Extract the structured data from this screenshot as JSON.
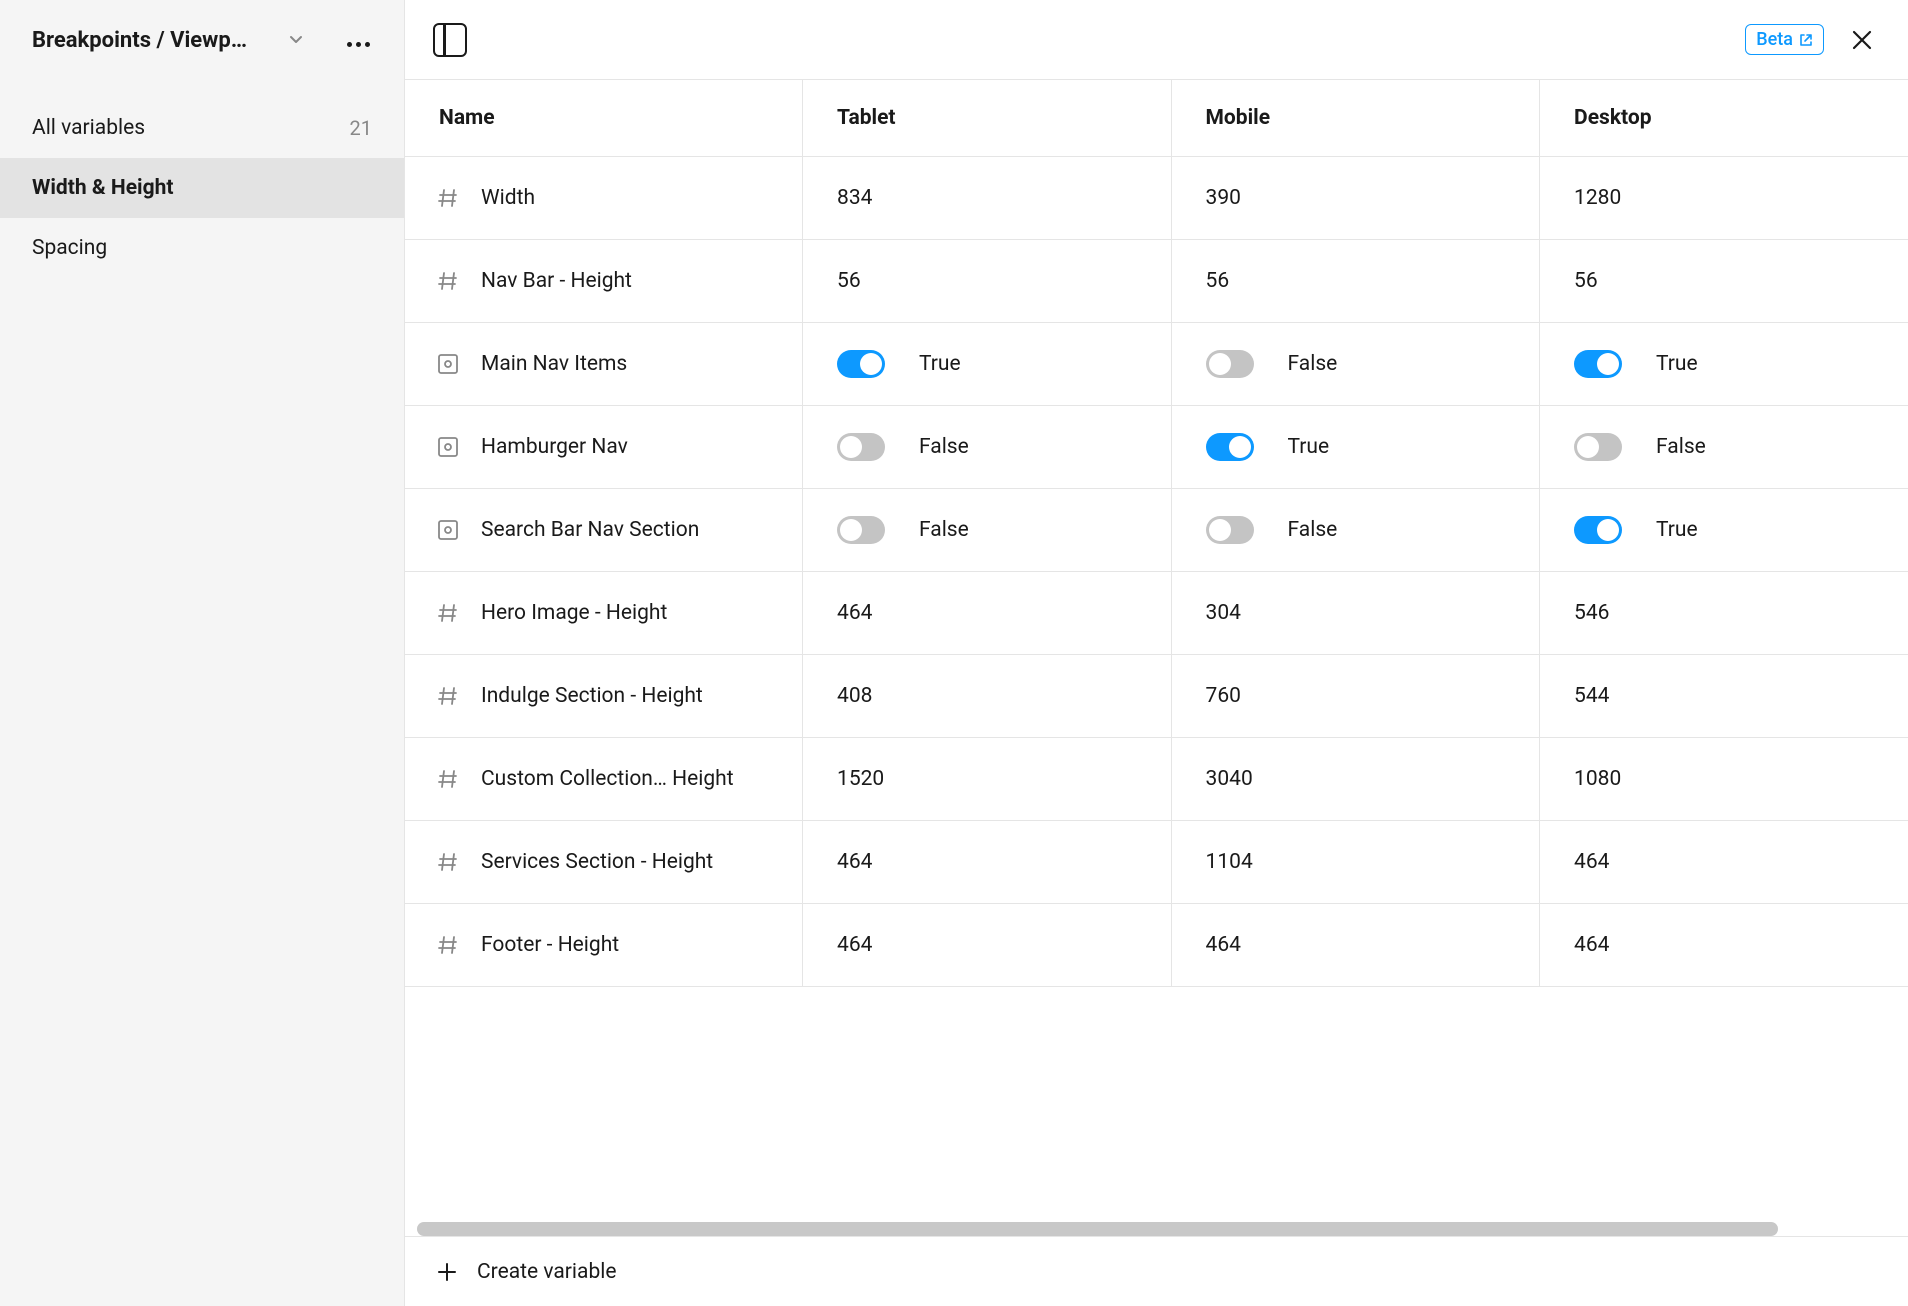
{
  "header": {
    "collection_name": "Breakpoints / Viewp…",
    "beta_label": "Beta"
  },
  "sidebar": {
    "items": [
      {
        "label": "All variables",
        "count": "21"
      },
      {
        "label": "Width & Height"
      },
      {
        "label": "Spacing"
      }
    ]
  },
  "columns": {
    "name": "Name",
    "modes": [
      "Tablet",
      "Mobile",
      "Desktop"
    ]
  },
  "rows": [
    {
      "type": "number",
      "name": "Width",
      "values": [
        "834",
        "390",
        "1280"
      ]
    },
    {
      "type": "number",
      "name": "Nav Bar - Height",
      "values": [
        "56",
        "56",
        "56"
      ]
    },
    {
      "type": "boolean",
      "name": "Main Nav Items",
      "values": [
        true,
        false,
        true
      ]
    },
    {
      "type": "boolean",
      "name": "Hamburger Nav",
      "values": [
        false,
        true,
        false
      ]
    },
    {
      "type": "boolean",
      "name": "Search Bar Nav Section",
      "values": [
        false,
        false,
        true
      ]
    },
    {
      "type": "number",
      "name": "Hero Image - Height",
      "values": [
        "464",
        "304",
        "546"
      ]
    },
    {
      "type": "number",
      "name": "Indulge Section - Height",
      "values": [
        "408",
        "760",
        "544"
      ]
    },
    {
      "type": "number",
      "name": "Custom Collection…  Height",
      "values": [
        "1520",
        "3040",
        "1080"
      ]
    },
    {
      "type": "number",
      "name": "Services Section - Height",
      "values": [
        "464",
        "1104",
        "464"
      ]
    },
    {
      "type": "number",
      "name": "Footer - Height",
      "values": [
        "464",
        "464",
        "464"
      ]
    }
  ],
  "bool_labels": {
    "true": "True",
    "false": "False"
  },
  "footer": {
    "create_label": "Create variable"
  }
}
